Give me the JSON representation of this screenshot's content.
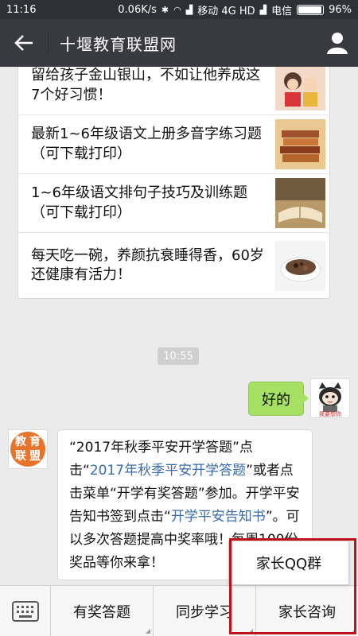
{
  "status_bar": {
    "time": "11:16",
    "net_speed": "0.06K/s",
    "carrier": "移动 4G HD",
    "carrier2": "电信",
    "battery": "96%",
    "battery_level": 0.96
  },
  "header": {
    "title": "十堰教育联盟网"
  },
  "articles": [
    {
      "title": "留给孩子金山银山，不如让他养成这7个好习惯！"
    },
    {
      "title": "最新1~6年级语文上册多音字练习题（可下载打印）"
    },
    {
      "title": "1~6年级语文排句子技巧及训练题（可下载打印）"
    },
    {
      "title": "每天吃一碗，养颜抗衰睡得香，60岁还健康有活力！"
    }
  ],
  "timestamp": "10:55",
  "messages": {
    "user": {
      "text": "好的",
      "avatar_caption": "我要想你"
    },
    "bot": {
      "logo_chars": [
        "教",
        "育",
        "联",
        "盟"
      ],
      "parts": [
        "“2017年秋季平安开学答题”点击“",
        "2017年秋季平安开学答题",
        "”或者点击菜单“开学有奖答题”参加。开学平安告知书签到点击“",
        "开学平安告知书",
        "”。可以多次答题提高中奖率哦！每周100份奖品等你来拿！"
      ]
    }
  },
  "menu": {
    "items": [
      "有奖答题",
      "同步学习",
      "家长咨询"
    ],
    "submenu_item": "家长QQ群"
  },
  "colors": {
    "accent_green": "#a6e163",
    "link": "#3b6ca8",
    "highlight_red": "#c1121b",
    "header_bg": "#393a3f"
  }
}
